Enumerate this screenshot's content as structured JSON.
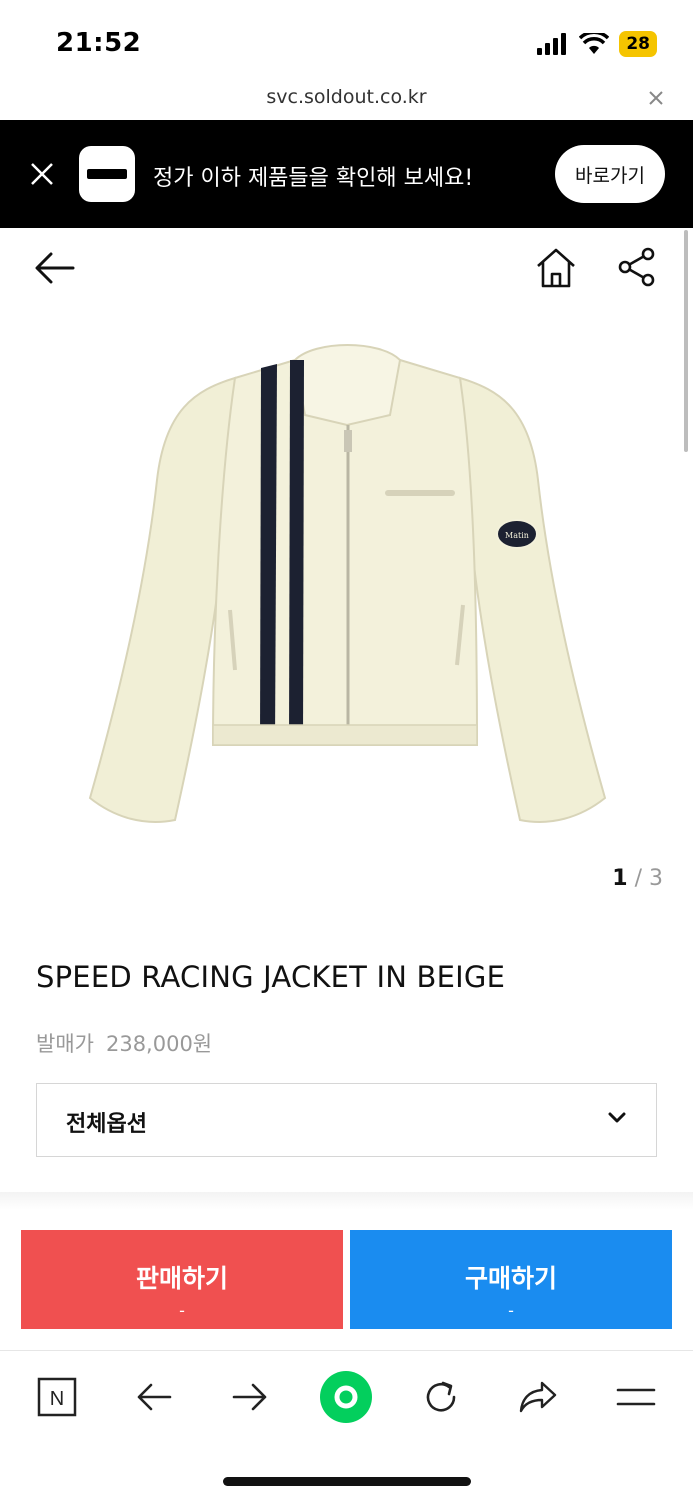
{
  "status_bar": {
    "time": "21:52",
    "battery": "28"
  },
  "url_bar": {
    "url": "svc.soldout.co.kr"
  },
  "promo": {
    "message": "정가 이하 제품들을 확인해 보세요!",
    "button_label": "바로가기"
  },
  "gallery": {
    "current": "1",
    "separator": "/",
    "total": "3"
  },
  "product": {
    "title": "SPEED RACING JACKET IN BEIGE",
    "price_label": "발매가",
    "price_value": "238,000원",
    "patch_text": "Matin"
  },
  "option": {
    "label": "전체옵션"
  },
  "actions": {
    "sell_label": "판매하기",
    "sell_sub": "-",
    "buy_label": "구매하기",
    "buy_sub": "-"
  },
  "toolbar": {
    "items": [
      "naver-icon",
      "back-icon",
      "forward-icon",
      "green-dot-icon",
      "reload-icon",
      "share-icon",
      "menu-icon"
    ],
    "naver_letter": "N"
  },
  "colors": {
    "banner_bg": "#000000",
    "sell": "#f05050",
    "buy": "#1a8cf0",
    "battery": "#f5c400",
    "toolbar_dot": "#03cf5d",
    "jacket": "#f1efd6",
    "stripe": "#1c2131"
  }
}
